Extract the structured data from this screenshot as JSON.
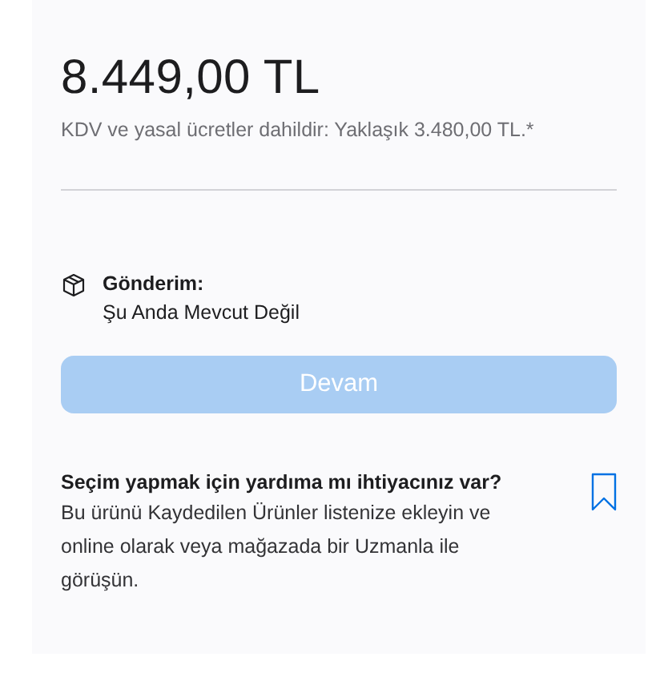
{
  "price": "8.449,00 TL",
  "price_note": "KDV ve yasal ücretler dahildir: Yaklaşık 3.480,00 TL.*",
  "shipping": {
    "label": "Gönderim:",
    "status": "Şu Anda Mevcut Değil"
  },
  "continue_button": {
    "label": "Devam",
    "disabled": true
  },
  "help": {
    "title": "Seçim yapmak için yardıma mı ihtiyacınız var?",
    "text": "Bu ürünü Kaydedilen Ürünler listenize ekleyin ve online olarak veya mağazada bir Uzmanla ile görüşün."
  }
}
